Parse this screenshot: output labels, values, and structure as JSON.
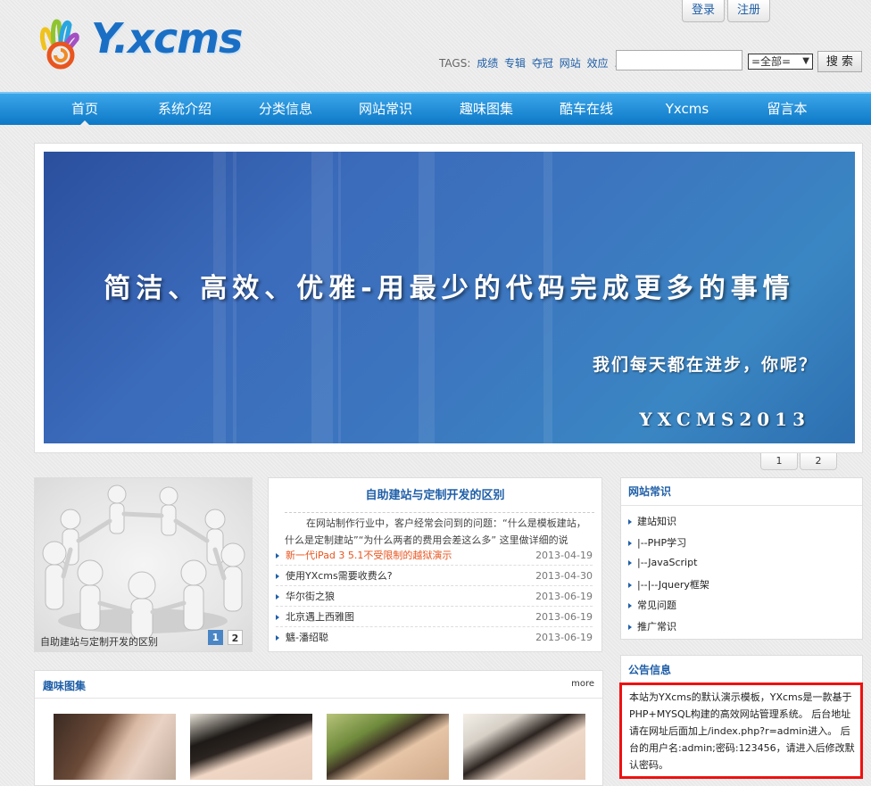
{
  "header": {
    "login_label": "登录",
    "register_label": "注册",
    "logo_text": "Y.xcms",
    "tags_label": "TAGS:",
    "tags": [
      "成绩",
      "专辑",
      "夺冠",
      "网站",
      "效应",
      "..."
    ],
    "search_placeholder": "",
    "search_select_value": "=全部=",
    "search_button_label": "搜 索"
  },
  "nav": {
    "items": [
      "首页",
      "系统介绍",
      "分类信息",
      "网站常识",
      "趣味图集",
      "酷车在线",
      "Yxcms",
      "留言本"
    ],
    "active_index": 0
  },
  "banner": {
    "headline": "简洁、高效、优雅-用最少的代码完成更多的事情",
    "subline": "我们每天都在进步，你呢？",
    "brand": "YXCMS2013",
    "pages": [
      "1",
      "2"
    ]
  },
  "focus_box": {
    "caption": "自助建站与定制开发的区别",
    "pages": [
      "1",
      "2"
    ],
    "active_page": "1"
  },
  "article_box": {
    "title": "自助建站与定制开发的区别",
    "excerpt": "在网站制作行业中，客户经常会问到的问题：“什么是模板建站，什么是定制建站”“为什么两者的费用会差这么多” 这里做详细的说",
    "news": [
      {
        "title": "新一代iPad 3 5.1不受限制的越狱演示",
        "date": "2013-04-19",
        "highlight": true
      },
      {
        "title": "使用YXcms需要收费么?",
        "date": "2013-04-30",
        "highlight": false
      },
      {
        "title": "华尔街之狼",
        "date": "2013-06-19",
        "highlight": false
      },
      {
        "title": "北京遇上西雅图",
        "date": "2013-06-19",
        "highlight": false
      },
      {
        "title": "魑-潘绍聪",
        "date": "2013-06-19",
        "highlight": false
      }
    ]
  },
  "knowledge_box": {
    "title": "网站常识",
    "links": [
      "建站知识",
      "|--PHP学习",
      "|--JavaScript",
      "|--|--Jquery框架",
      "常见问题",
      "推广常识"
    ]
  },
  "notice_box": {
    "title": "公告信息",
    "text": "本站为YXcms的默认演示模板，YXcms是一款基于PHP+MYSQL构建的高效网站管理系统。 后台地址请在网址后面加上/index.php?r=admin进入。 后台的用户名:admin;密码:123456，请进入后修改默认密码。"
  },
  "gallery_box": {
    "title": "趣味图集",
    "more_label": "more"
  },
  "colors": {
    "nav_top": "#3ba6ea",
    "nav_bottom": "#0d78c6",
    "link_blue": "#1f5fa8",
    "highlight_orange": "#e8551f",
    "notice_border": "#ee1111"
  }
}
